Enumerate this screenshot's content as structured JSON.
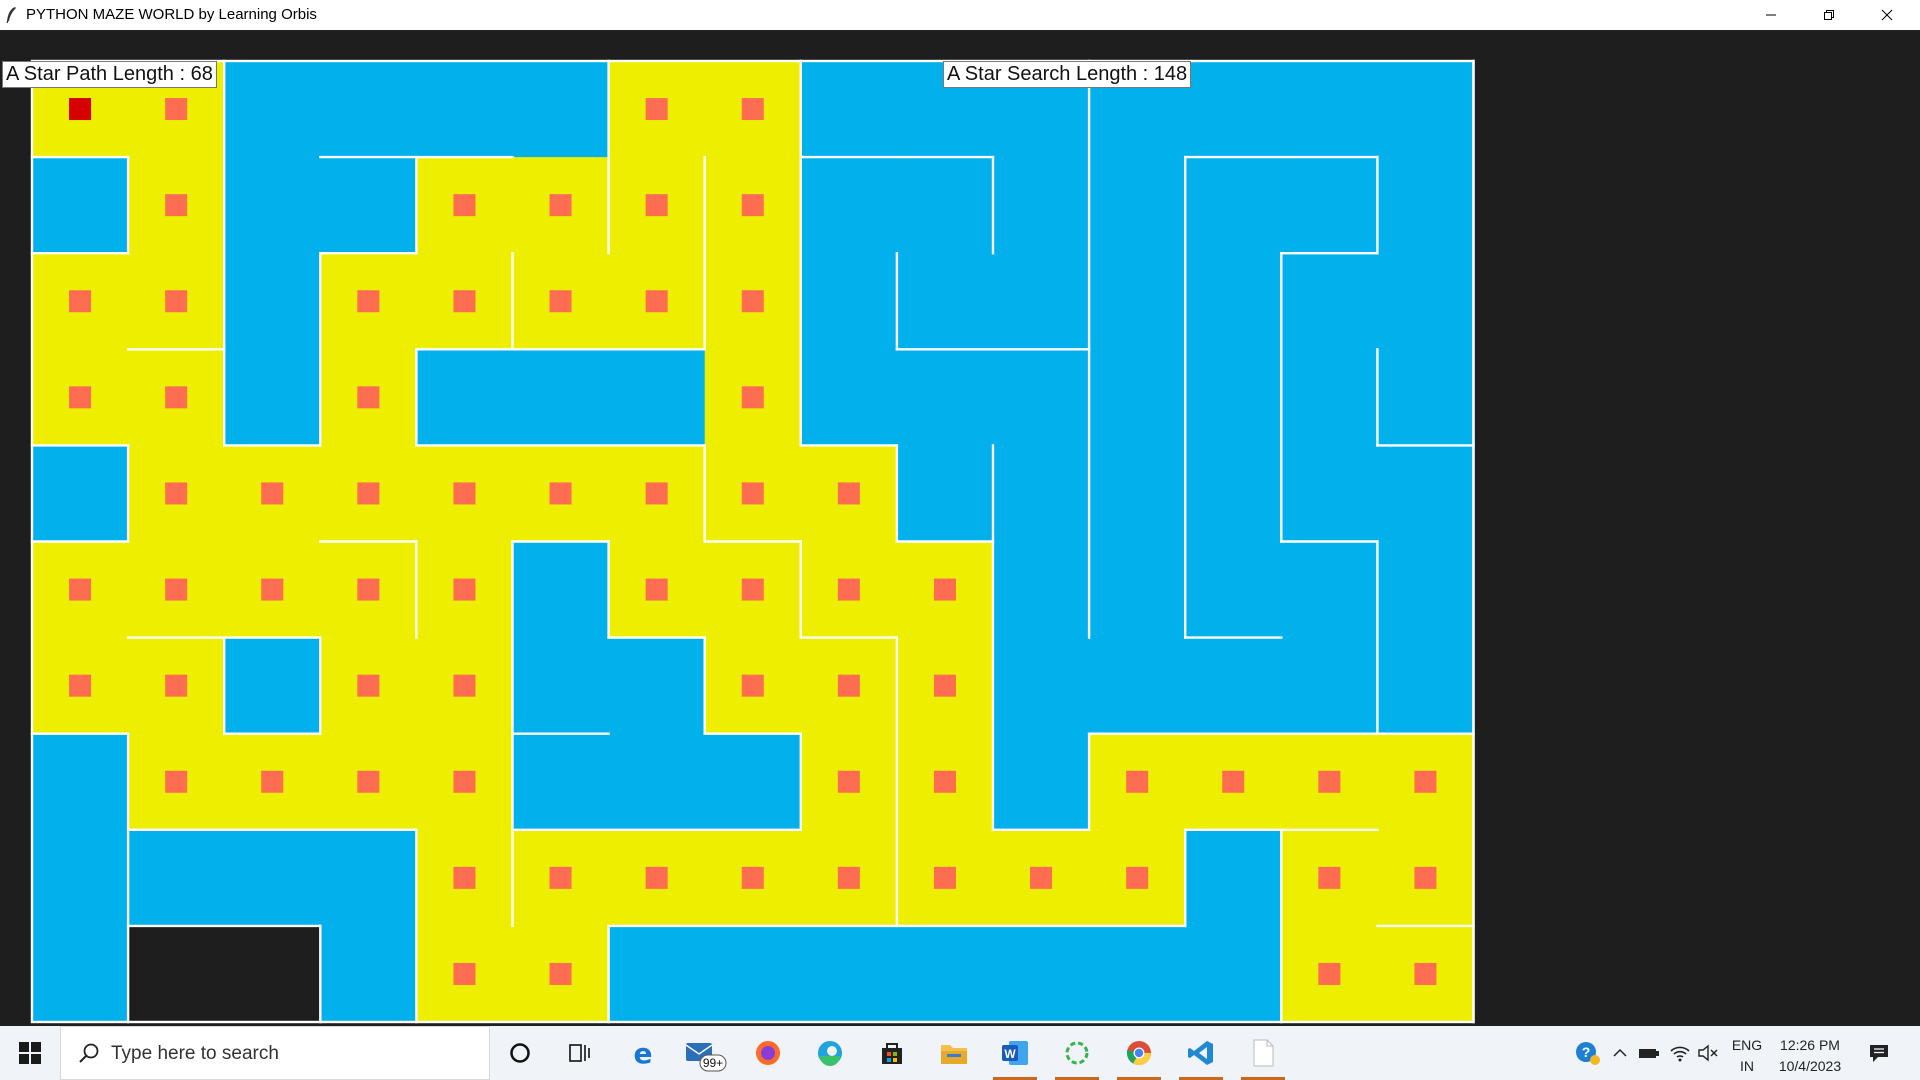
{
  "window": {
    "title": "PYTHON MAZE WORLD by Learning Orbis",
    "controls": [
      "minimize",
      "restore",
      "close"
    ]
  },
  "labels": {
    "path_length": "A Star Path Length : 68",
    "search_length": "A Star Search Length : 148"
  },
  "maze": {
    "rows": 10,
    "cols": 15,
    "colors": {
      "visited": "#02b0ec",
      "path": "#eeee00",
      "dot": "#fc6d52",
      "goal": "#d70000",
      "unexplored": "#1e1e1e",
      "background": "#1e1e1e",
      "wall": "#ffffff"
    },
    "cell_types": [
      "PPVVVVPPVVVVVVV",
      "VPVVPPPPVVVVVVV",
      "PPVPPPPPVVVVVVV",
      "PPVPVVVPVVVVVVV",
      "VPPPPPPPPVVVVVV",
      "PPPPPVPPPPVVVVV",
      "PPVPPVVPPPVVVVV",
      "VPPPPVVVPPVPPPP",
      "VVVVPPPPPPPPVPP",
      "VUUVPPVVVVVVVPP"
    ],
    "dots": [
      "GP____PP_______",
      "_P__PPPP_______",
      "PP_PPPPP_______",
      "PP_P___P_______",
      "_PPPPPPPP______",
      "PPPPP_PPPP_____",
      "PP_PP__PPP_____",
      "_PPPP___PP_PPPP",
      "____PPPPPPPP_PP",
      "____PP_______PP"
    ],
    "walls": {
      "horizontal": [
        {
          "row": 1,
          "from_col": 0,
          "to_col": 1
        },
        {
          "row": 1,
          "from_col": 3,
          "to_col": 5
        },
        {
          "row": 1,
          "from_col": 8,
          "to_col": 10
        },
        {
          "row": 1,
          "from_col": 12,
          "to_col": 14
        },
        {
          "row": 2,
          "from_col": 0,
          "to_col": 1
        },
        {
          "row": 2,
          "from_col": 3,
          "to_col": 4
        },
        {
          "row": 2,
          "from_col": 13,
          "to_col": 14
        },
        {
          "row": 3,
          "from_col": 1,
          "to_col": 2
        },
        {
          "row": 3,
          "from_col": 4,
          "to_col": 7
        },
        {
          "row": 3,
          "from_col": 9,
          "to_col": 11
        },
        {
          "row": 4,
          "from_col": 4,
          "to_col": 7
        },
        {
          "row": 4,
          "from_col": 0,
          "to_col": 1
        },
        {
          "row": 4,
          "from_col": 2,
          "to_col": 3
        },
        {
          "row": 4,
          "from_col": 8,
          "to_col": 9
        },
        {
          "row": 4,
          "from_col": 14,
          "to_col": 15
        },
        {
          "row": 5,
          "from_col": 0,
          "to_col": 1
        },
        {
          "row": 5,
          "from_col": 3,
          "to_col": 4
        },
        {
          "row": 5,
          "from_col": 5,
          "to_col": 6
        },
        {
          "row": 5,
          "from_col": 7,
          "to_col": 8
        },
        {
          "row": 5,
          "from_col": 9,
          "to_col": 10
        },
        {
          "row": 5,
          "from_col": 13,
          "to_col": 14
        },
        {
          "row": 6,
          "from_col": 1,
          "to_col": 3
        },
        {
          "row": 6,
          "from_col": 6,
          "to_col": 7
        },
        {
          "row": 6,
          "from_col": 8,
          "to_col": 9
        },
        {
          "row": 6,
          "from_col": 12,
          "to_col": 13
        },
        {
          "row": 7,
          "from_col": 0,
          "to_col": 1
        },
        {
          "row": 7,
          "from_col": 2,
          "to_col": 3
        },
        {
          "row": 7,
          "from_col": 5,
          "to_col": 6
        },
        {
          "row": 7,
          "from_col": 7,
          "to_col": 8
        },
        {
          "row": 7,
          "from_col": 11,
          "to_col": 15
        },
        {
          "row": 8,
          "from_col": 1,
          "to_col": 4
        },
        {
          "row": 8,
          "from_col": 5,
          "to_col": 8
        },
        {
          "row": 8,
          "from_col": 10,
          "to_col": 11
        },
        {
          "row": 8,
          "from_col": 12,
          "to_col": 14
        },
        {
          "row": 9,
          "from_col": 1,
          "to_col": 3
        },
        {
          "row": 9,
          "from_col": 6,
          "to_col": 12
        },
        {
          "row": 9,
          "from_col": 14,
          "to_col": 15
        }
      ],
      "vertical": [
        {
          "col": 1,
          "from_row": 1,
          "to_row": 2
        },
        {
          "col": 1,
          "from_row": 4,
          "to_row": 5
        },
        {
          "col": 1,
          "from_row": 7,
          "to_row": 10
        },
        {
          "col": 2,
          "from_row": 0,
          "to_row": 4
        },
        {
          "col": 2,
          "from_row": 6,
          "to_row": 7
        },
        {
          "col": 3,
          "from_row": 2,
          "to_row": 4
        },
        {
          "col": 3,
          "from_row": 6,
          "to_row": 7
        },
        {
          "col": 3,
          "from_row": 9,
          "to_row": 10
        },
        {
          "col": 4,
          "from_row": 1,
          "to_row": 2
        },
        {
          "col": 4,
          "from_row": 3,
          "to_row": 4
        },
        {
          "col": 4,
          "from_row": 5,
          "to_row": 6
        },
        {
          "col": 4,
          "from_row": 8,
          "to_row": 10
        },
        {
          "col": 5,
          "from_row": 2,
          "to_row": 3
        },
        {
          "col": 5,
          "from_row": 5,
          "to_row": 7
        },
        {
          "col": 5,
          "from_row": 7,
          "to_row": 9
        },
        {
          "col": 6,
          "from_row": 0,
          "to_row": 2
        },
        {
          "col": 6,
          "from_row": 5,
          "to_row": 6
        },
        {
          "col": 6,
          "from_row": 9,
          "to_row": 10
        },
        {
          "col": 7,
          "from_row": 1,
          "to_row": 3
        },
        {
          "col": 7,
          "from_row": 4,
          "to_row": 5
        },
        {
          "col": 7,
          "from_row": 6,
          "to_row": 7
        },
        {
          "col": 8,
          "from_row": 0,
          "to_row": 4
        },
        {
          "col": 8,
          "from_row": 5,
          "to_row": 6
        },
        {
          "col": 8,
          "from_row": 7,
          "to_row": 8
        },
        {
          "col": 9,
          "from_row": 2,
          "to_row": 3
        },
        {
          "col": 9,
          "from_row": 4,
          "to_row": 5
        },
        {
          "col": 9,
          "from_row": 6,
          "to_row": 9
        },
        {
          "col": 10,
          "from_row": 1,
          "to_row": 2
        },
        {
          "col": 10,
          "from_row": 4,
          "to_row": 8
        },
        {
          "col": 11,
          "from_row": 0,
          "to_row": 6
        },
        {
          "col": 11,
          "from_row": 7,
          "to_row": 8
        },
        {
          "col": 12,
          "from_row": 1,
          "to_row": 6
        },
        {
          "col": 12,
          "from_row": 8,
          "to_row": 9
        },
        {
          "col": 13,
          "from_row": 2,
          "to_row": 5
        },
        {
          "col": 13,
          "from_row": 8,
          "to_row": 10
        },
        {
          "col": 14,
          "from_row": 1,
          "to_row": 2
        },
        {
          "col": 14,
          "from_row": 3,
          "to_row": 4
        },
        {
          "col": 14,
          "from_row": 5,
          "to_row": 7
        },
        {
          "col": 15,
          "from_row": 0,
          "to_row": 10
        }
      ]
    }
  },
  "taskbar": {
    "search_placeholder": "Type here to search",
    "mail_badge": "99+",
    "apps": [
      {
        "name": "cortana-icon",
        "label": "Cortana"
      },
      {
        "name": "task-view-icon",
        "label": "Task View"
      },
      {
        "name": "edge-legacy-icon",
        "label": "Internet Explorer"
      },
      {
        "name": "mail-icon",
        "label": "Mail"
      },
      {
        "name": "firefox-icon",
        "label": "Firefox"
      },
      {
        "name": "edge-icon",
        "label": "Microsoft Edge"
      },
      {
        "name": "store-icon",
        "label": "Microsoft Store"
      },
      {
        "name": "file-explorer-icon",
        "label": "File Explorer"
      },
      {
        "name": "word-icon",
        "label": "Word"
      },
      {
        "name": "loading-app-icon",
        "label": "App"
      },
      {
        "name": "chrome-icon",
        "label": "Chrome"
      },
      {
        "name": "vscode-icon",
        "label": "VS Code"
      },
      {
        "name": "blank-doc-icon",
        "label": "Document"
      }
    ],
    "lang_line1": "ENG",
    "lang_line2": "IN",
    "time": "12:26 PM",
    "date": "10/4/2023"
  }
}
